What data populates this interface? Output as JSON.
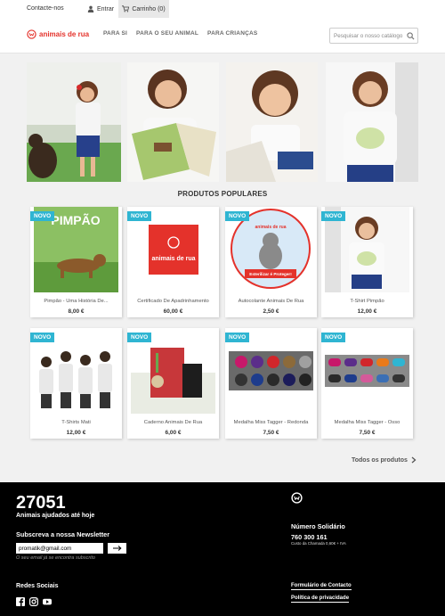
{
  "topnav": {
    "contact": "Contacte-nos",
    "login": "Entrar",
    "cart": "Carrinho (0)"
  },
  "header": {
    "logo_text": "animais de rua",
    "menu": [
      "PARA SI",
      "PARA O SEU ANIMAL",
      "PARA CRIANÇAS"
    ],
    "search_placeholder": "Pesquisar o nosso catálogo"
  },
  "section_title": "PRODUTOS POPULARES",
  "badge_label": "NOVO",
  "products": [
    {
      "name": "Pimpão - Uma História De...",
      "price": "8,00 €"
    },
    {
      "name": "Certificado De Apadrinhamento",
      "price": "60,00 €"
    },
    {
      "name": "Autocolante Animais De Rua",
      "price": "2,50 €"
    },
    {
      "name": "T-Shirt Pimpão",
      "price": "12,00 €"
    },
    {
      "name": "T-Shirts Mati",
      "price": "12,00 €"
    },
    {
      "name": "Caderno Animais De Rua",
      "price": "6,00 €"
    },
    {
      "name": "Medalha Miss Tagger - Redonda",
      "price": "7,50 €"
    },
    {
      "name": "Medalha Miss Tagger - Osso",
      "price": "7,50 €"
    }
  ],
  "product_art": {
    "book_title": "PIMPÃO",
    "certificate_logo": "animais de rua",
    "sticker_top": "animais de rua",
    "sticker_banner": "Esterilizar é Proteger!"
  },
  "all_products": "Todos os produtos",
  "footer": {
    "counter": "27051",
    "counter_label": "Animais ajudados até hoje",
    "newsletter_title": "Subscreva a nossa Newsletter",
    "newsletter_email": "promatik@gmail.com",
    "newsletter_note": "O seu email já se encontra subscrito",
    "social_title": "Redes Sociais",
    "number_title": "Número Solidário",
    "number": "760 300 161",
    "number_note": "Custo da Chamada 0,60€ + IVA",
    "links": [
      "Formulário de Contacto",
      "Política de privacidade"
    ]
  },
  "colors": {
    "brand": "#e4322b",
    "badge": "#2fb5d2",
    "footer_bg": "#000000",
    "page_bg": "#f1f1f1"
  }
}
